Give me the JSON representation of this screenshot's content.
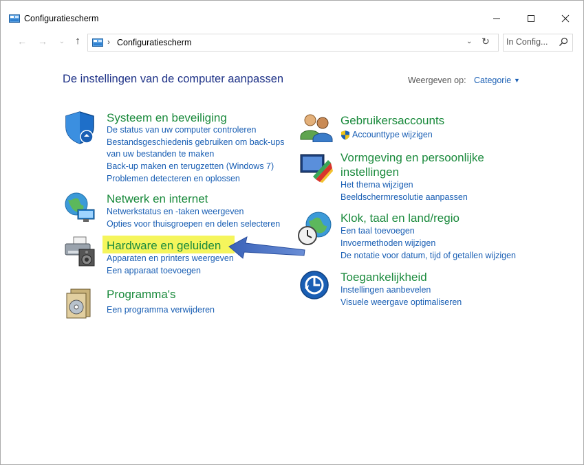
{
  "window": {
    "title": "Configuratiescherm",
    "minimize_icon": "minimize-icon",
    "maximize_icon": "maximize-icon",
    "close_icon": "close-icon"
  },
  "address_bar": {
    "breadcrumb": "Configuratiescherm",
    "search_placeholder": "In Config..."
  },
  "header": {
    "title": "De instellingen van de computer aanpassen",
    "view_label": "Weergeven op:",
    "view_value": "Categorie"
  },
  "categories": [
    {
      "title": "Systeem en beveiliging",
      "icon": "shield-icon",
      "links": [
        "De status van uw computer controleren",
        "Bestandsgeschiedenis gebruiken om back-ups",
        "van uw bestanden te maken",
        "Back-up maken en terugzetten (Windows 7)",
        "Problemen detecteren en oplossen"
      ]
    },
    {
      "title": "Netwerk en internet",
      "icon": "network-globe-icon",
      "links": [
        "Netwerkstatus en -taken weergeven",
        "Opties voor thuisgroepen en delen selecteren"
      ]
    },
    {
      "title": "Hardware en geluiden",
      "icon": "printer-speaker-icon",
      "highlighted": true,
      "links": [
        "Apparaten en printers weergeven",
        "Een apparaat toevoegen"
      ]
    },
    {
      "title": "Programma's",
      "icon": "programs-icon",
      "links": [
        "Een programma verwijderen"
      ]
    },
    {
      "title": "Gebruikersaccounts",
      "icon": "users-icon",
      "links": [
        "Accounttype wijzigen"
      ],
      "link_icon": "uac-shield-icon"
    },
    {
      "title": "Vormgeving en persoonlijke",
      "title2": "instellingen",
      "icon": "appearance-icon",
      "links": [
        "Het thema wijzigen",
        "Beeldschermresolutie aanpassen"
      ]
    },
    {
      "title": "Klok, taal en land/regio",
      "icon": "clock-globe-icon",
      "links": [
        "Een taal toevoegen",
        "Invoermethoden wijzigen",
        "De notatie voor datum, tijd of getallen wijzigen"
      ]
    },
    {
      "title": "Toegankelijkheid",
      "icon": "accessibility-icon",
      "links": [
        "Instellingen aanbevelen",
        "Visuele weergave optimaliseren"
      ]
    }
  ],
  "colors": {
    "title_blue": "#1e3287",
    "category_green": "#1a8a3c",
    "link_blue": "#1a5fb4",
    "highlight_yellow": "#f4f44a",
    "arrow_blue": "#4a72c8"
  }
}
